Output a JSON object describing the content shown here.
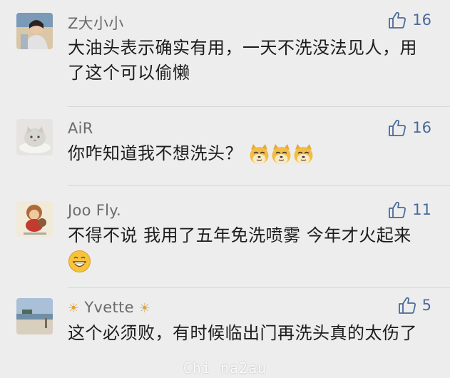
{
  "comments": [
    {
      "username": "Z大小小",
      "like_count": "16",
      "text": "大油头表示确实有用，一天不洗没法见人，用了这个可以偷懒"
    },
    {
      "username": "AiR",
      "like_count": "16",
      "text": "你咋知道我不想洗头？",
      "emojis": [
        "doge-icon",
        "doge-icon",
        "doge-icon"
      ]
    },
    {
      "username": "Joo Fly.",
      "like_count": "11",
      "text": "不得不说 我用了五年免洗喷雾 今年才火起来",
      "emojis": [
        "grinning-face-icon"
      ]
    },
    {
      "username": "Yvette",
      "username_decoration": "☀",
      "like_count": "5",
      "text": "这个必须败，有时候临出门再洗头真的太伤了"
    }
  ],
  "watermark": "Chi na2au",
  "colors": {
    "background": "#ededed",
    "username": "#6b6b6b",
    "like": "#4a6a9a",
    "text": "#1c1c1c"
  }
}
